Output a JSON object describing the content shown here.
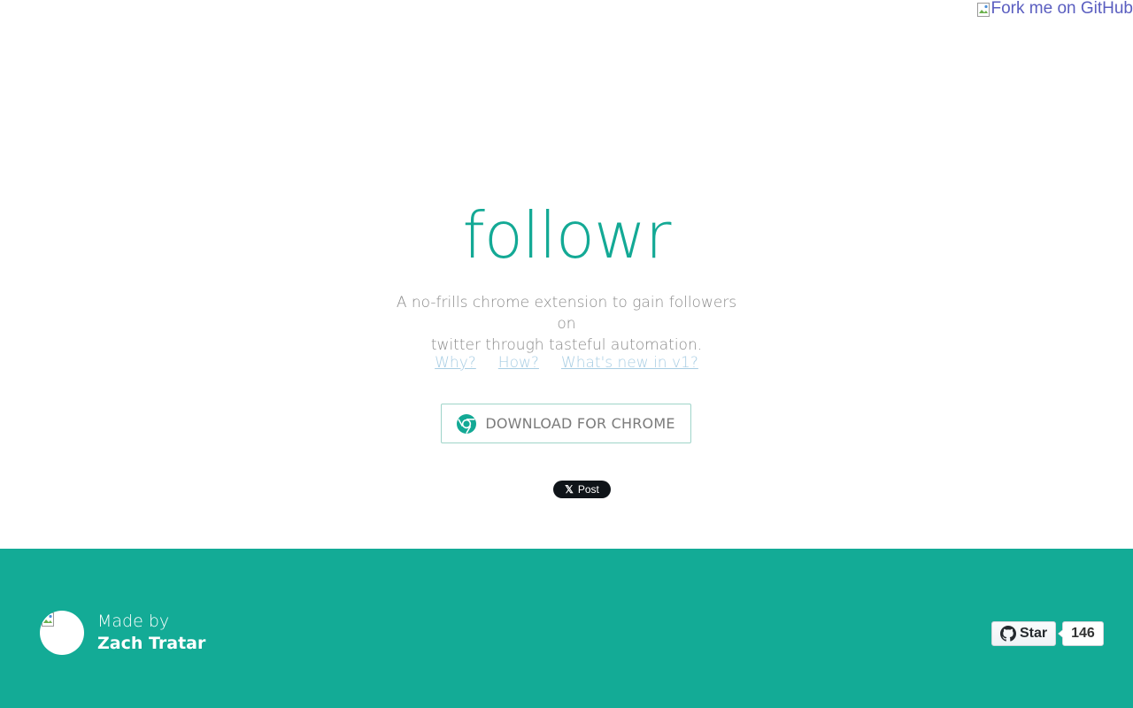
{
  "ribbon": {
    "alt_text": "Fork me on GitHub"
  },
  "hero": {
    "logo": "followr",
    "tagline_line1": "A no-frills chrome extension to gain followers on",
    "tagline_line2": "twitter through tasteful automation.",
    "links": [
      {
        "label": "Why?"
      },
      {
        "label": "How?"
      },
      {
        "label": "What's new in v1?"
      }
    ],
    "download_label": "DOWNLOAD FOR CHROME",
    "post_label": "Post",
    "post_icon": "x-logo-icon"
  },
  "footer": {
    "made_by_label": "Made by",
    "author_name": "Zach Tratar",
    "star_label": "Star",
    "star_count": "146"
  },
  "colors": {
    "brand": "#13a995",
    "footer_bg": "#13ab96",
    "link": "#a8cde3",
    "ribbon_text": "#5a5ec0"
  }
}
